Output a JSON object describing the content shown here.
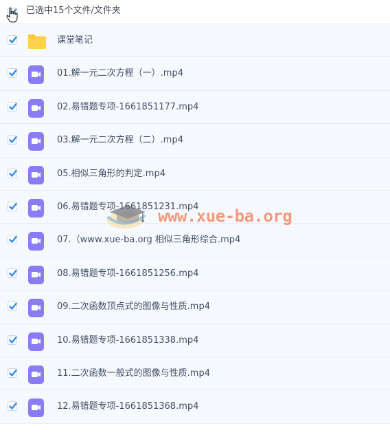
{
  "header": {
    "selection_label": "已选中15个文件/文件夹"
  },
  "files": [
    {
      "name": "课堂笔记",
      "type": "folder",
      "checked": true
    },
    {
      "name": "01.解一元二次方程（一）.mp4",
      "type": "video",
      "checked": true
    },
    {
      "name": "02.易错题专项-1661851177.mp4",
      "type": "video",
      "checked": true
    },
    {
      "name": "03.解一元二次方程（二）.mp4",
      "type": "video",
      "checked": true
    },
    {
      "name": "05.相似三角形的判定.mp4",
      "type": "video",
      "checked": true
    },
    {
      "name": "06.易错题专项-1661851231.mp4",
      "type": "video",
      "checked": true
    },
    {
      "name": "07.（www.xue-ba.org 相似三角形综合.mp4",
      "type": "video",
      "checked": true
    },
    {
      "name": "08.易错题专项-1661851256.mp4",
      "type": "video",
      "checked": true
    },
    {
      "name": "09.二次函数顶点式的图像与性质.mp4",
      "type": "video",
      "checked": true
    },
    {
      "name": "10.易错题专项-1661851338.mp4",
      "type": "video",
      "checked": true
    },
    {
      "name": "11.二次函数一般式的图像与性质.mp4",
      "type": "video",
      "checked": true
    },
    {
      "name": "12.易错题专项-1661851368.mp4",
      "type": "video",
      "checked": true
    }
  ],
  "watermark": {
    "text": "www.xue-ba.org"
  },
  "colors": {
    "check_blue": "#2f8cf0",
    "video_icon": "#8b7cf6",
    "folder_icon": "#fcc93e",
    "row_bg": "#f6faff",
    "text": "#424e66"
  }
}
